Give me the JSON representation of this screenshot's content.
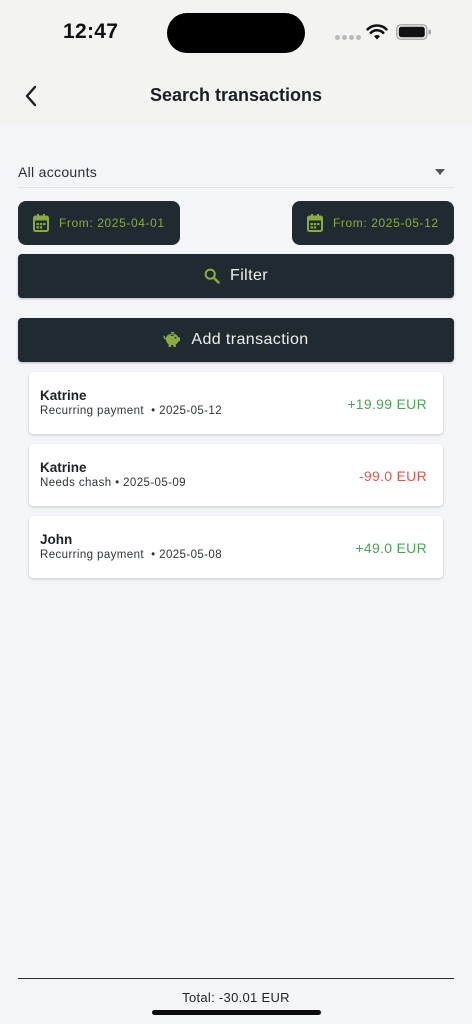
{
  "status_bar": {
    "time": "12:47"
  },
  "header": {
    "title": "Search transactions"
  },
  "account_select": {
    "value": "All accounts"
  },
  "date_filters": {
    "from": "From: 2025-04-01",
    "to": "From: 2025-05-12"
  },
  "buttons": {
    "filter_label": "Filter",
    "add_label": "Add transaction"
  },
  "transactions": [
    {
      "name": "Katrine",
      "subtitle": "Recurring payment  • 2025-05-12",
      "amount": "+19.99 EUR",
      "direction": "positive"
    },
    {
      "name": "Katrine",
      "subtitle": "Needs chash • 2025-05-09",
      "amount": "-99.0 EUR",
      "direction": "negative"
    },
    {
      "name": "John",
      "subtitle": "Recurring payment  • 2025-05-08",
      "amount": "+49.0 EUR",
      "direction": "positive"
    }
  ],
  "footer": {
    "total": "Total: -30.01 EUR"
  },
  "colors": {
    "button_bg": "#1f2b31",
    "accent_green": "#8cab3f",
    "positive": "#4aa553",
    "negative": "#e2574a",
    "background": "#f4f5f9"
  },
  "icons": {
    "back": "chevron-left-icon",
    "calendar": "calendar-icon",
    "search": "search-icon",
    "piggy_bank": "piggy-bank-icon",
    "dropdown": "dropdown-arrow-icon"
  }
}
